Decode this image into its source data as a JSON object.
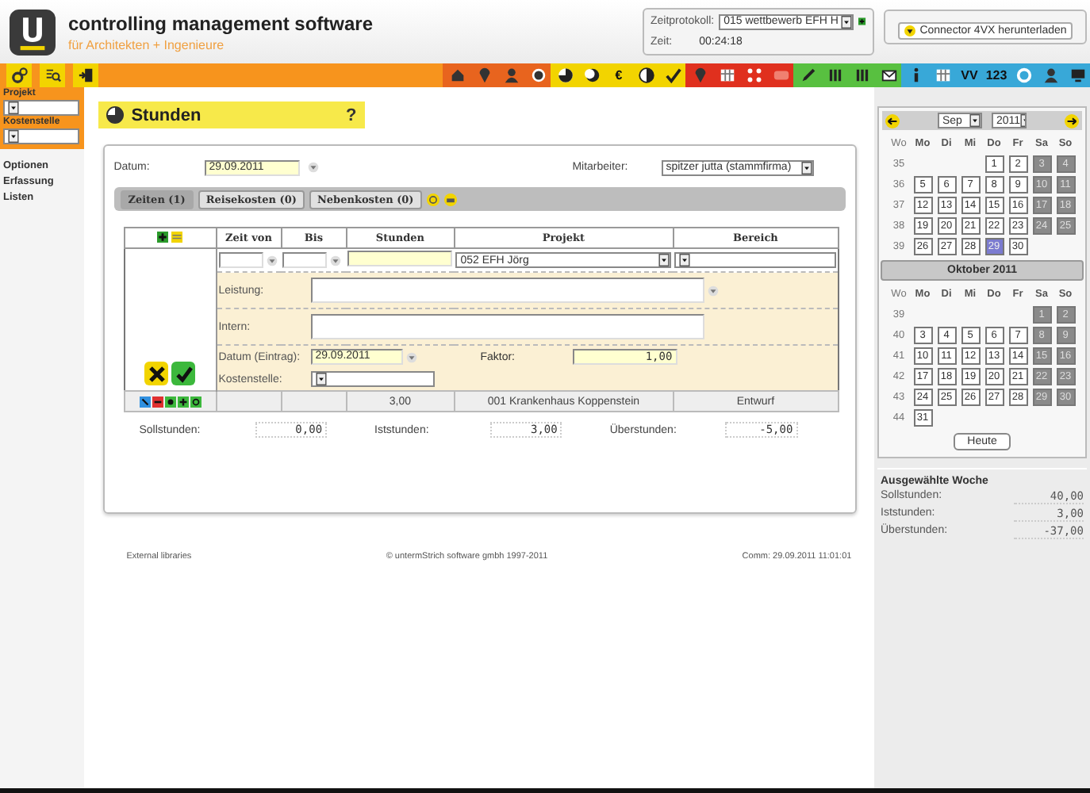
{
  "app": {
    "title": "controlling management software",
    "subtitle": "für Architekten + Ingenieure"
  },
  "zeitprotokoll": {
    "label": "Zeitprotokoll:",
    "value": "015 wettbewerb EFH H",
    "zeit_label": "Zeit:",
    "zeit": "00:24:18"
  },
  "connector": {
    "label": "Connector 4VX herunterladen"
  },
  "toolbar": {
    "left": [
      {
        "kind": "gear"
      },
      {
        "kind": "list"
      },
      {
        "kind": "exit"
      }
    ],
    "groups": [
      {
        "color": "#e8641e",
        "icons": [
          {
            "kind": "house"
          },
          {
            "kind": "pin"
          },
          {
            "kind": "person"
          },
          {
            "kind": "dot"
          }
        ]
      },
      {
        "color": "#f2d400",
        "icons": [
          {
            "kind": "pie"
          },
          {
            "kind": "moon"
          },
          {
            "kind": "glyph",
            "glyph": "€"
          },
          {
            "kind": "half"
          },
          {
            "kind": "check"
          }
        ]
      },
      {
        "color": "#e0301e",
        "icons": [
          {
            "kind": "pin"
          },
          {
            "kind": "table"
          },
          {
            "kind": "dots"
          },
          {
            "kind": "card"
          }
        ]
      },
      {
        "color": "#58c040",
        "icons": [
          {
            "kind": "pencil"
          },
          {
            "kind": "bars"
          },
          {
            "kind": "bars"
          },
          {
            "kind": "mail"
          }
        ]
      },
      {
        "color": "#38a8d8",
        "icons": [
          {
            "kind": "info"
          },
          {
            "kind": "table"
          },
          {
            "kind": "glyph",
            "glyph": "VV"
          },
          {
            "kind": "glyph",
            "glyph": "123"
          },
          {
            "kind": "ring"
          },
          {
            "kind": "person"
          },
          {
            "kind": "monitor"
          }
        ]
      }
    ]
  },
  "sidebar": {
    "fields": [
      {
        "label": "Projekt"
      },
      {
        "label": "Kostenstelle"
      }
    ],
    "links": [
      "Optionen",
      "Erfassung",
      "Listen"
    ]
  },
  "page": {
    "title": "Stunden",
    "help": "?"
  },
  "form": {
    "datum_label": "Datum:",
    "datum": "29.09.2011",
    "mitarbeiter_label": "Mitarbeiter:",
    "mitarbeiter": "spitzer jutta (stammfirma)"
  },
  "tabs": [
    {
      "label": "Zeiten (1)",
      "selected": true
    },
    {
      "label": "Reisekosten (0)",
      "selected": false
    },
    {
      "label": "Nebenkosten (0)",
      "selected": false
    }
  ],
  "table": {
    "columns": [
      "Zeit von",
      "Bis",
      "Stunden",
      "Projekt",
      "Bereich"
    ],
    "edit": {
      "projekt": "052 EFH Jörg",
      "leistung_label": "Leistung:",
      "intern_label": "Intern:",
      "datum_label": "Datum (Eintrag):",
      "datum": "29.09.2011",
      "faktor_label": "Faktor:",
      "faktor": "1,00",
      "kostenstelle_label": "Kostenstelle:"
    },
    "rows": [
      {
        "stunden": "3,00",
        "projekt": "001 Krankenhaus Koppenstein",
        "bereich": "Entwurf"
      }
    ]
  },
  "summary": [
    {
      "label": "Sollstunden:",
      "value": "0,00"
    },
    {
      "label": "Iststunden:",
      "value": "3,00"
    },
    {
      "label": "Überstunden:",
      "value": "-5,00"
    }
  ],
  "footer": [
    "External libraries",
    "© untermStrich software gmbh 1997-2011",
    "Comm: 29.09.2011 11:01:01"
  ],
  "calendar": {
    "month": "Sep",
    "year": "2011",
    "today": "Heute",
    "months": [
      {
        "weekdays": [
          "Wo",
          "Mo",
          "Di",
          "Mi",
          "Do",
          "Fr",
          "Sa",
          "So"
        ],
        "weeks": [
          {
            "wo": "35",
            "kind": "first",
            "days": [
              {
                "d": "1",
                "selected": false
              },
              {
                "d": "2",
                "selected": false
              },
              {
                "d": "3",
                "selected": false
              },
              {
                "d": "4",
                "selected": false
              }
            ]
          },
          {
            "wo": "36",
            "kind": "full",
            "days": [
              {
                "d": "5",
                "selected": false
              },
              {
                "d": "6",
                "selected": false
              },
              {
                "d": "7",
                "selected": false
              },
              {
                "d": "8",
                "selected": false
              },
              {
                "d": "9",
                "selected": false
              },
              {
                "d": "10",
                "selected": false
              },
              {
                "d": "11",
                "selected": false
              }
            ]
          },
          {
            "wo": "37",
            "kind": "full",
            "days": [
              {
                "d": "12",
                "selected": false
              },
              {
                "d": "13",
                "selected": false
              },
              {
                "d": "14",
                "selected": false
              },
              {
                "d": "15",
                "selected": false
              },
              {
                "d": "16",
                "selected": false
              },
              {
                "d": "17",
                "selected": false
              },
              {
                "d": "18",
                "selected": false
              }
            ]
          },
          {
            "wo": "38",
            "kind": "full",
            "days": [
              {
                "d": "19",
                "selected": false
              },
              {
                "d": "20",
                "selected": false
              },
              {
                "d": "21",
                "selected": false
              },
              {
                "d": "22",
                "selected": false
              },
              {
                "d": "23",
                "selected": false
              },
              {
                "d": "24",
                "selected": false
              },
              {
                "d": "25",
                "selected": false
              }
            ]
          },
          {
            "wo": "39",
            "kind": "last",
            "days": [
              {
                "d": "26",
                "selected": false
              },
              {
                "d": "27",
                "selected": false
              },
              {
                "d": "28",
                "selected": false
              },
              {
                "d": "29",
                "selected": true
              },
              {
                "d": "30",
                "selected": false
              }
            ]
          }
        ]
      },
      {
        "title": "Oktober 2011",
        "weekdays": [
          "Wo",
          "Mo",
          "Di",
          "Mi",
          "Do",
          "Fr",
          "Sa",
          "So"
        ],
        "weeks": [
          {
            "wo": "39",
            "kind": "first",
            "days": [
              {
                "d": "1",
                "selected": false
              },
              {
                "d": "2",
                "selected": false
              }
            ]
          },
          {
            "wo": "40",
            "kind": "full",
            "days": [
              {
                "d": "3",
                "selected": false
              },
              {
                "d": "4",
                "selected": false
              },
              {
                "d": "5",
                "selected": false
              },
              {
                "d": "6",
                "selected": false
              },
              {
                "d": "7",
                "selected": false
              },
              {
                "d": "8",
                "selected": false
              },
              {
                "d": "9",
                "selected": false
              }
            ]
          },
          {
            "wo": "41",
            "kind": "full",
            "days": [
              {
                "d": "10",
                "selected": false
              },
              {
                "d": "11",
                "selected": false
              },
              {
                "d": "12",
                "selected": false
              },
              {
                "d": "13",
                "selected": false
              },
              {
                "d": "14",
                "selected": false
              },
              {
                "d": "15",
                "selected": false
              },
              {
                "d": "16",
                "selected": false
              }
            ]
          },
          {
            "wo": "42",
            "kind": "full",
            "days": [
              {
                "d": "17",
                "selected": false
              },
              {
                "d": "18",
                "selected": false
              },
              {
                "d": "19",
                "selected": false
              },
              {
                "d": "20",
                "selected": false
              },
              {
                "d": "21",
                "selected": false
              },
              {
                "d": "22",
                "selected": false
              },
              {
                "d": "23",
                "selected": false
              }
            ]
          },
          {
            "wo": "43",
            "kind": "full",
            "days": [
              {
                "d": "24",
                "selected": false
              },
              {
                "d": "25",
                "selected": false
              },
              {
                "d": "26",
                "selected": false
              },
              {
                "d": "27",
                "selected": false
              },
              {
                "d": "28",
                "selected": false
              },
              {
                "d": "29",
                "selected": false
              },
              {
                "d": "30",
                "selected": false
              }
            ]
          },
          {
            "wo": "44",
            "kind": "last",
            "days": [
              {
                "d": "31",
                "selected": false
              }
            ]
          }
        ]
      }
    ]
  },
  "week_summary": {
    "title": "Ausgewählte Woche",
    "rows": [
      {
        "label": "Sollstunden:",
        "value": "40,00"
      },
      {
        "label": "Iststunden:",
        "value": "3,00"
      },
      {
        "label": "Überstunden:",
        "value": "-37,00"
      }
    ]
  }
}
